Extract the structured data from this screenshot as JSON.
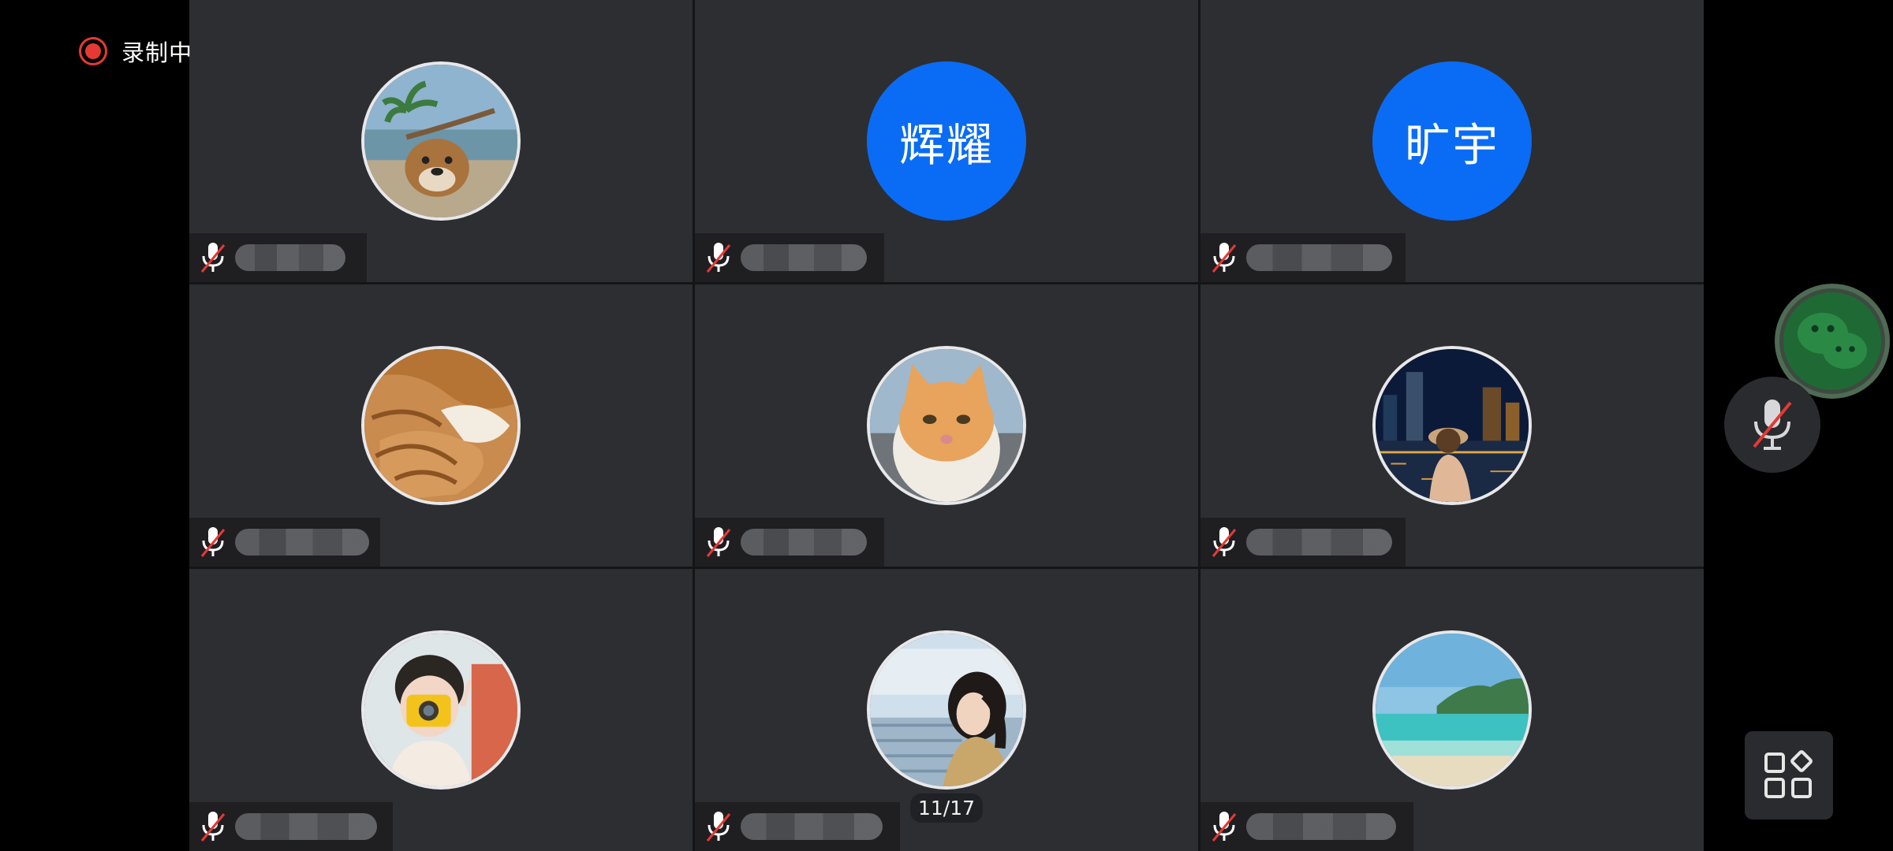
{
  "recording": {
    "label": "录制中",
    "color": "#e53935"
  },
  "pagination": {
    "text": "11/17"
  },
  "participants": [
    {
      "avatar_type": "photo",
      "avatar_desc": "palm-tree-dog-icon",
      "mic": "muted"
    },
    {
      "avatar_type": "text",
      "avatar_text": "辉耀",
      "mic": "muted"
    },
    {
      "avatar_type": "text",
      "avatar_text": "旷宇",
      "mic": "muted"
    },
    {
      "avatar_type": "photo",
      "avatar_desc": "sleeping-cat-icon",
      "mic": "muted"
    },
    {
      "avatar_type": "photo",
      "avatar_desc": "orange-cat-icon",
      "mic": "muted"
    },
    {
      "avatar_type": "photo",
      "avatar_desc": "night-city-person-icon",
      "mic": "muted"
    },
    {
      "avatar_type": "photo",
      "avatar_desc": "child-camera-icon",
      "mic": "muted"
    },
    {
      "avatar_type": "photo",
      "avatar_desc": "girl-stadium-icon",
      "mic": "muted"
    },
    {
      "avatar_type": "photo",
      "avatar_desc": "beach-icon",
      "mic": "muted"
    }
  ],
  "controls": {
    "wechat": "wechat-icon",
    "mic": "mic-muted-icon",
    "layout": "grid-layout-icon"
  },
  "colors": {
    "avatar_blue": "#0a6cf5",
    "tile_bg": "#2d2e31",
    "muted_red": "#e53935"
  }
}
